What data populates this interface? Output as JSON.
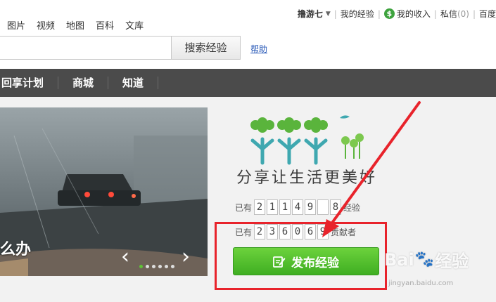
{
  "nav": {
    "links": [
      "图片",
      "视频",
      "地图",
      "百科",
      "文库"
    ],
    "user": {
      "username": "撸游七",
      "my_experience": "我的经验",
      "my_income": "我的收入",
      "messages_label": "私信",
      "messages_count": "(0)",
      "baidu": "百度"
    }
  },
  "search": {
    "value": "",
    "button_label": "搜索经验",
    "help_label": "帮助"
  },
  "categories": [
    "回享计划",
    "商城",
    "知道"
  ],
  "banner": {
    "caption": "么办",
    "slide_count": 6,
    "active_slide": 1
  },
  "stats": {
    "slogan": "分享让生活更美好",
    "experience": {
      "prefix": "已有",
      "digits": [
        "2",
        "1",
        "1",
        "4",
        "9",
        "",
        "8"
      ],
      "suffix": "经验"
    },
    "contributors": {
      "prefix": "已有",
      "digits": [
        "2",
        "3",
        "6",
        "0",
        "6",
        "9"
      ],
      "suffix": "贡献者"
    },
    "publish_label": "发布经验"
  },
  "annotation": {
    "color": "#e8232b"
  },
  "watermark": {
    "brand_left": "Bai",
    "brand_right": "经验",
    "sub": "jingyan.baidu.com"
  },
  "colors": {
    "accent_green": "#3fae22",
    "category_bar": "#4b4b4b",
    "link_blue": "#2a5ab8"
  }
}
